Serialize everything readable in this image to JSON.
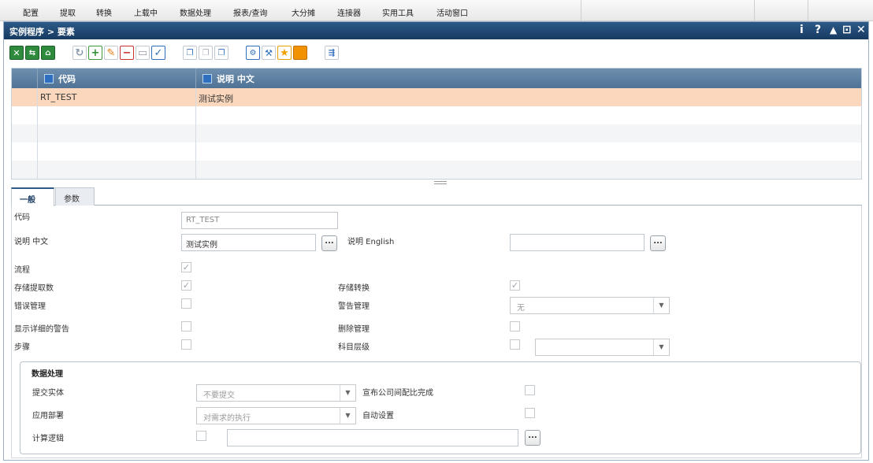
{
  "menu": [
    "配置",
    "提取",
    "转换",
    "上载中",
    "数据处理",
    "报表/查询",
    "大分摊",
    "连接器",
    "实用工具",
    "活动窗口"
  ],
  "window": {
    "title": "实例程序 > 要素",
    "controls": [
      "i",
      "?",
      "▲",
      "⊡",
      "✕"
    ]
  },
  "grid": {
    "columns": [
      "代码",
      "说明 中文"
    ],
    "rows": [
      {
        "code": "RT_TEST",
        "desc": "测试实例"
      }
    ]
  },
  "tabs": [
    "一般",
    "参数"
  ],
  "form": {
    "code_label": "代码",
    "code_value": "RT_TEST",
    "desc_cn_label": "说明 中文",
    "desc_cn_value": "测试实例",
    "desc_en_label": "说明 English",
    "desc_en_value": "",
    "dots": "...",
    "process_label": "流程",
    "store_extract_label": "存储提取数",
    "store_transform_label": "存储转换",
    "error_mgmt_label": "错误管理",
    "warning_mgmt_label": "警告管理",
    "warning_mgmt_value": "无",
    "show_warning_label": "显示详细的警告",
    "delete_mgmt_label": "删除管理",
    "steps_label": "步骤",
    "account_level_label": "科目层级",
    "account_level_value": "",
    "check_mark": "✓"
  },
  "data_section": {
    "title": "数据处理",
    "submit_entity_label": "提交实体",
    "submit_entity_value": "不要提交",
    "publish_label": "宣布公司间配比完成",
    "apply_deploy_label": "应用部署",
    "apply_deploy_value": "对需求的执行",
    "auto_setup_label": "自动设置",
    "calc_logic_label": "计算逻辑",
    "calc_logic_value": "",
    "arrow": "▼"
  },
  "colors": {
    "title_bar": "#1f4670",
    "grid_header": "#5b7ea2",
    "selected_row": "#fbd8bd",
    "active_tab": "#2d5a88"
  }
}
